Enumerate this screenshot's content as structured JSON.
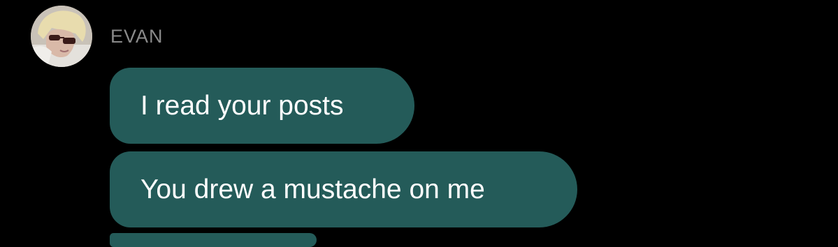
{
  "conversation": {
    "sender_name": "EVAN",
    "avatar_icon": "user-avatar-photo",
    "bubble_color": "#245b59",
    "messages": [
      {
        "text": "I read your posts"
      },
      {
        "text": "You drew a mustache on me"
      },
      {
        "text": ""
      }
    ]
  }
}
